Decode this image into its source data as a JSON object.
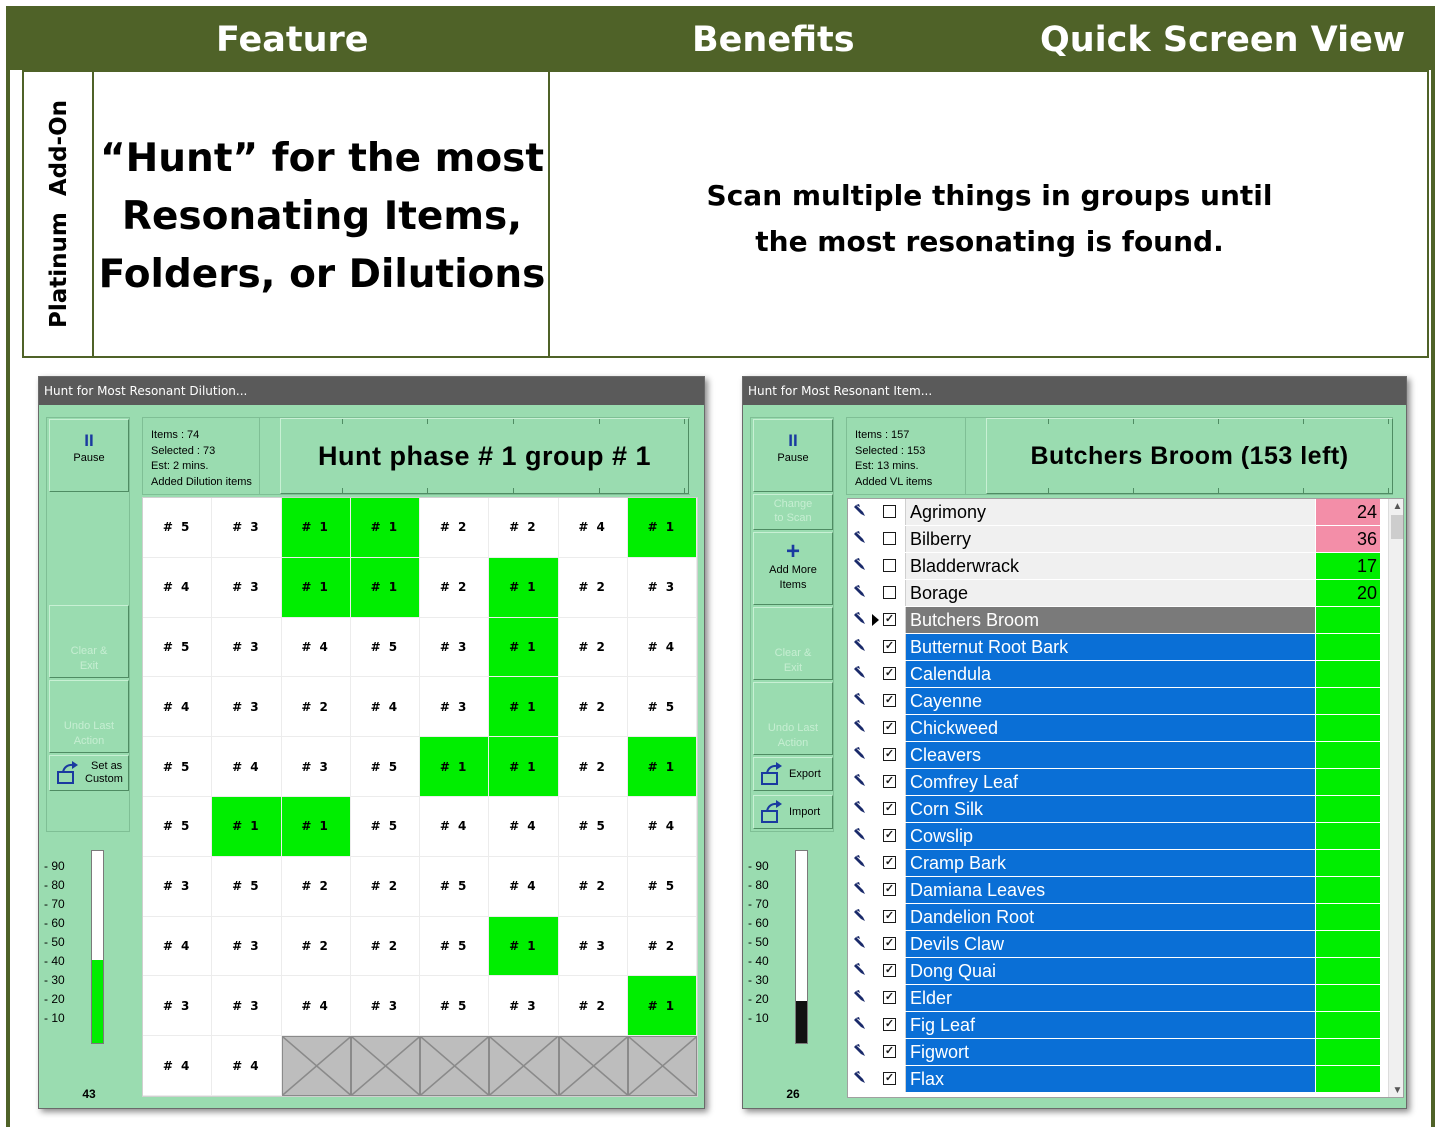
{
  "header": {
    "col_feature": "Feature",
    "col_benefits": "Benefits",
    "col_quick_view": "Quick Screen View"
  },
  "feature": {
    "category": "Platinum  Add-On",
    "title_line1": "“Hunt” for the most",
    "title_line2": "Resonating Items,",
    "title_line3": "Folders, or Dilutions",
    "benefit_line1": "Scan multiple things in groups until",
    "benefit_line2": "the most resonating is found."
  },
  "dilution_window": {
    "title": "Hunt for Most Resonant Dilution...",
    "pause_label": "Pause",
    "clear_label_1": "Clear &",
    "clear_label_2": "Exit",
    "undo_label_1": "Undo Last",
    "undo_label_2": "Action",
    "custom_label_1": "Set as",
    "custom_label_2": "Custom",
    "info_items": "Items : 74",
    "info_selected": "Selected : 73",
    "info_est": "Est: 2 mins.",
    "info_added": "Added Dilution items",
    "status": "Hunt phase # 1 group # 1",
    "meter_ticks": [
      "90",
      "80",
      "70",
      "60",
      "50",
      "40",
      "30",
      "20",
      "10"
    ],
    "meter_level": 43,
    "meter_value": "43",
    "meter_color": "#00ee00",
    "hit_color": "#00ee00",
    "grid": [
      [
        "# 5",
        "# 3",
        "# 1",
        "# 1",
        "# 2",
        "# 2",
        "# 4",
        "# 1"
      ],
      [
        "# 4",
        "# 3",
        "# 1",
        "# 1",
        "# 2",
        "# 1",
        "# 2",
        "# 3"
      ],
      [
        "# 5",
        "# 3",
        "# 4",
        "# 5",
        "# 3",
        "# 1",
        "# 2",
        "# 4"
      ],
      [
        "# 4",
        "# 3",
        "# 2",
        "# 4",
        "# 3",
        "# 1",
        "# 2",
        "# 5"
      ],
      [
        "# 5",
        "# 4",
        "# 3",
        "# 5",
        "# 1",
        "# 1",
        "# 2",
        "# 1"
      ],
      [
        "# 5",
        "# 1",
        "# 1",
        "# 5",
        "# 4",
        "# 4",
        "# 5",
        "# 4"
      ],
      [
        "# 3",
        "# 5",
        "# 2",
        "# 2",
        "# 5",
        "# 4",
        "# 2",
        "# 5"
      ],
      [
        "# 4",
        "# 3",
        "# 2",
        "# 2",
        "# 5",
        "# 1",
        "# 3",
        "# 2"
      ],
      [
        "# 3",
        "# 3",
        "# 4",
        "# 3",
        "# 5",
        "# 3",
        "# 2",
        "# 1"
      ],
      [
        "# 4",
        "# 4",
        "",
        "",
        "",
        "",
        "",
        ""
      ]
    ],
    "highlighted": [
      [
        0,
        2
      ],
      [
        0,
        3
      ],
      [
        0,
        7
      ],
      [
        1,
        2
      ],
      [
        1,
        3
      ],
      [
        1,
        5
      ],
      [
        2,
        5
      ],
      [
        3,
        5
      ],
      [
        4,
        4
      ],
      [
        4,
        5
      ],
      [
        4,
        7
      ],
      [
        5,
        1
      ],
      [
        5,
        2
      ],
      [
        7,
        5
      ],
      [
        8,
        7
      ]
    ]
  },
  "item_window": {
    "title": "Hunt for Most Resonant Item...",
    "pause_label": "Pause",
    "change_label_1": "Change",
    "change_label_2": "to Scan",
    "add_label_1": "Add More",
    "add_label_2": "Items",
    "clear_label_1": "Clear &",
    "clear_label_2": "Exit",
    "undo_label_1": "Undo Last",
    "undo_label_2": "Action",
    "export_label": "Export",
    "import_label": "Import",
    "info_items": "Items : 157",
    "info_selected": "Selected : 153",
    "info_est": "Est: 13 mins.",
    "info_added": "Added VL items",
    "status": "Butchers Broom (153 left)",
    "meter_ticks": [
      "90",
      "80",
      "70",
      "60",
      "50",
      "40",
      "30",
      "20",
      "10"
    ],
    "meter_level": 22,
    "meter_value": "26",
    "meter_color": "#111111",
    "items": [
      {
        "name": "Agrimony",
        "value": "24",
        "state": "plain",
        "checked": false,
        "score_color": "pink"
      },
      {
        "name": "Bilberry",
        "value": "36",
        "state": "plain",
        "checked": false,
        "score_color": "pink"
      },
      {
        "name": "Bladderwrack",
        "value": "17",
        "state": "plain",
        "checked": false,
        "score_color": "green"
      },
      {
        "name": "Borage",
        "value": "20",
        "state": "plain",
        "checked": false,
        "score_color": "green"
      },
      {
        "name": "Butchers Broom",
        "value": "",
        "state": "current",
        "checked": true,
        "score_color": "green"
      },
      {
        "name": "Butternut Root Bark",
        "value": "",
        "state": "selected",
        "checked": true,
        "score_color": "green"
      },
      {
        "name": "Calendula",
        "value": "",
        "state": "selected",
        "checked": true,
        "score_color": "green"
      },
      {
        "name": "Cayenne",
        "value": "",
        "state": "selected",
        "checked": true,
        "score_color": "green"
      },
      {
        "name": "Chickweed",
        "value": "",
        "state": "selected",
        "checked": true,
        "score_color": "green"
      },
      {
        "name": "Cleavers",
        "value": "",
        "state": "selected",
        "checked": true,
        "score_color": "green"
      },
      {
        "name": "Comfrey Leaf",
        "value": "",
        "state": "selected",
        "checked": true,
        "score_color": "green"
      },
      {
        "name": "Corn Silk",
        "value": "",
        "state": "selected",
        "checked": true,
        "score_color": "green"
      },
      {
        "name": "Cowslip",
        "value": "",
        "state": "selected",
        "checked": true,
        "score_color": "green"
      },
      {
        "name": "Cramp Bark",
        "value": "",
        "state": "selected",
        "checked": true,
        "score_color": "green"
      },
      {
        "name": "Damiana Leaves",
        "value": "",
        "state": "selected",
        "checked": true,
        "score_color": "green"
      },
      {
        "name": "Dandelion Root",
        "value": "",
        "state": "selected",
        "checked": true,
        "score_color": "green"
      },
      {
        "name": "Devils Claw",
        "value": "",
        "state": "selected",
        "checked": true,
        "score_color": "green"
      },
      {
        "name": "Dong Quai",
        "value": "",
        "state": "selected",
        "checked": true,
        "score_color": "green"
      },
      {
        "name": "Elder",
        "value": "",
        "state": "selected",
        "checked": true,
        "score_color": "green"
      },
      {
        "name": "Fig Leaf",
        "value": "",
        "state": "selected",
        "checked": true,
        "score_color": "green"
      },
      {
        "name": "Figwort",
        "value": "",
        "state": "selected",
        "checked": true,
        "score_color": "green"
      },
      {
        "name": "Flax",
        "value": "",
        "state": "selected",
        "checked": true,
        "score_color": "green"
      }
    ]
  },
  "colors": {
    "frame_green": "#4f6228",
    "window_bg": "#9adcb0",
    "selection_blue": "#0a6fd6",
    "score_green": "#00ee00",
    "score_pink": "#f38ea8"
  }
}
